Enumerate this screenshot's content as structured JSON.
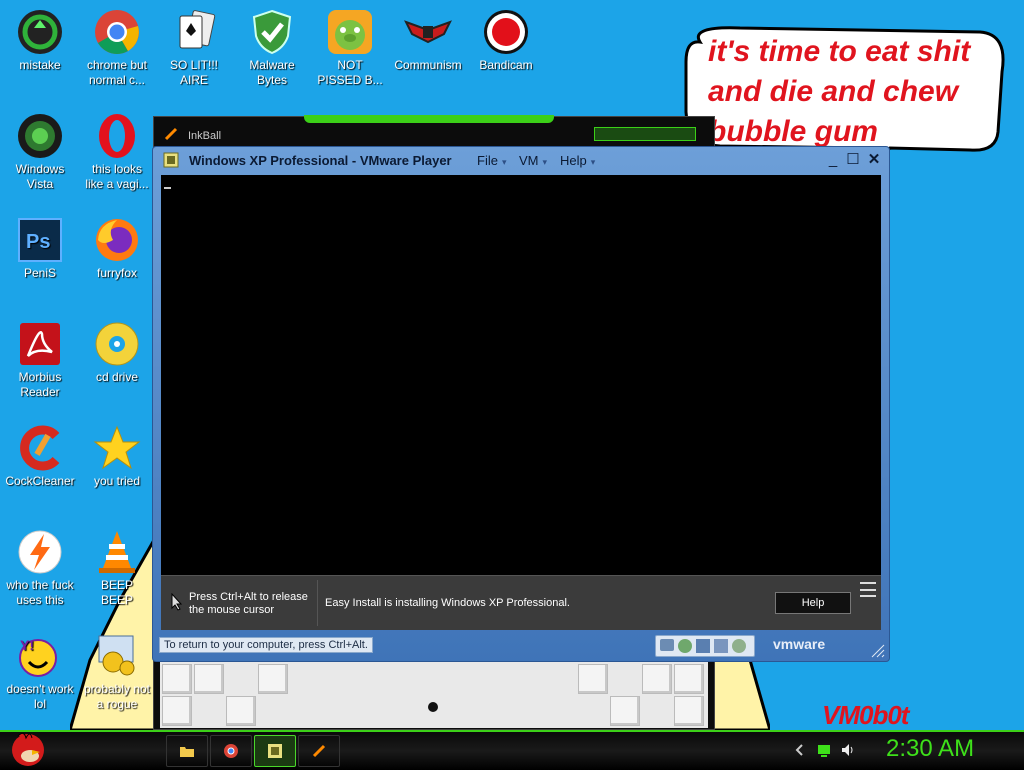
{
  "desktop_icons": [
    {
      "label": "mistake",
      "icon": "green-recycle-icon"
    },
    {
      "label": "chrome but\nnormal c...",
      "icon": "chrome-icon"
    },
    {
      "label": "SO LIT!!!\nAIRE",
      "icon": "solitaire-card-icon"
    },
    {
      "label": "Malware\nBytes",
      "icon": "shield-check-icon"
    },
    {
      "label": "NOT\nPISSED B...",
      "icon": "angry-pig-icon"
    },
    {
      "label": "Communism",
      "icon": "winged-emblem-icon"
    },
    {
      "label": "Bandicam",
      "icon": "record-icon"
    },
    {
      "label": "Windows\nVista",
      "icon": "vista-recycle-icon"
    },
    {
      "label": "this looks\nlike a vagi...",
      "icon": "opera-icon"
    },
    {
      "label": "PeniS",
      "icon": "photoshop-icon"
    },
    {
      "label": "furryfox",
      "icon": "firefox-icon"
    },
    {
      "label": "Morbius\nReader",
      "icon": "acrobat-icon"
    },
    {
      "label": "cd drive",
      "icon": "cd-icon"
    },
    {
      "label": "CockCleaner",
      "icon": "ccleaner-icon"
    },
    {
      "label": "you tried",
      "icon": "star-icon"
    },
    {
      "label": "who the fuck\nuses this",
      "icon": "lightning-icon"
    },
    {
      "label": "BEEP\nBEEP",
      "icon": "vlc-cone-icon"
    },
    {
      "label": "doesn't work\nlol",
      "icon": "yahoo-smiley-icon"
    },
    {
      "label": "probably not\na rogue",
      "icon": "gears-icon"
    }
  ],
  "bubble": {
    "text": "it's time to eat shit\nand die and chew\nbubble gum"
  },
  "inkball": {
    "title": "InkBall"
  },
  "vmware": {
    "title": "Windows XP Professional - VMware Player",
    "menus": [
      "File",
      "VM",
      "Help"
    ],
    "release_notice": "Press Ctrl+Alt to release\nthe mouse cursor",
    "install_notice": "Easy Install is installing Windows XP Professional.",
    "help_button": "Help",
    "status_text": "To return to your computer, press Ctrl+Alt.",
    "brand": "vmware"
  },
  "watermark": "VM0b0t",
  "taskbar": {
    "clock": "2:30 AM",
    "accent": "#3cd018"
  }
}
